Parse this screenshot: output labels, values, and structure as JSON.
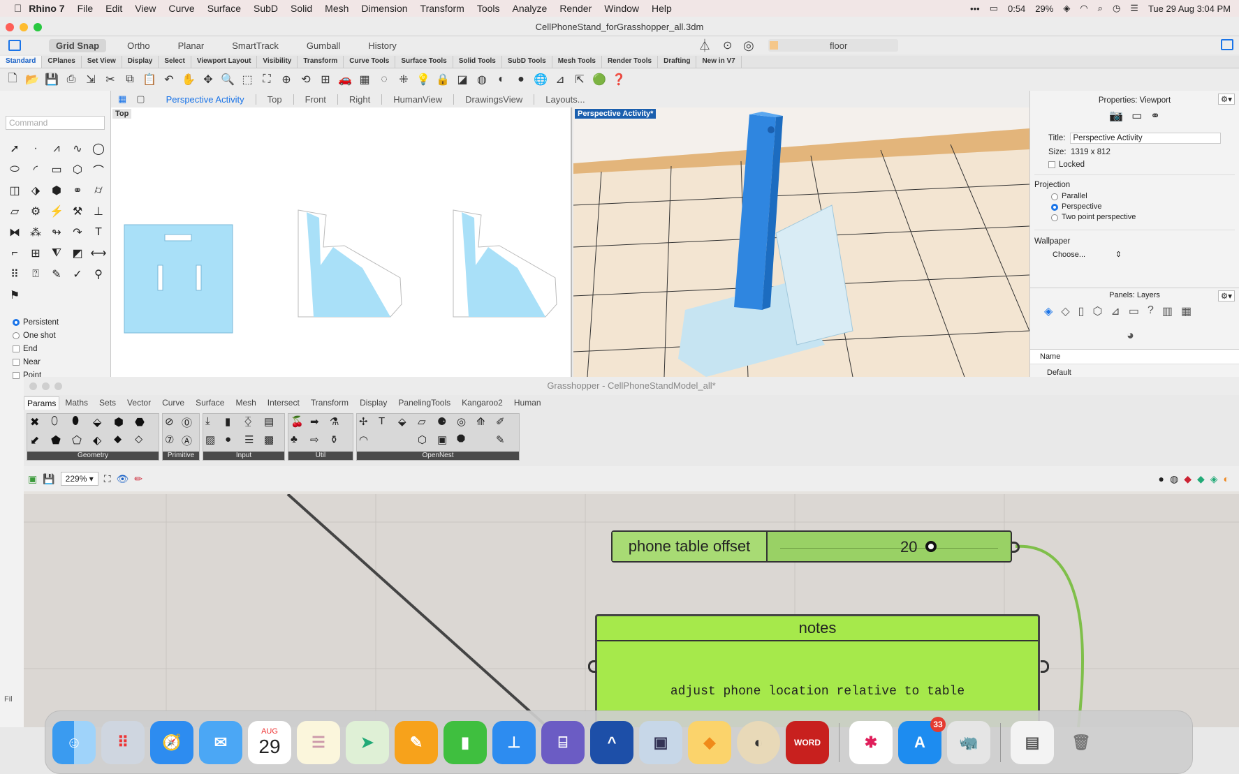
{
  "menubar": {
    "app": "Rhino 7",
    "items": [
      "File",
      "Edit",
      "View",
      "Curve",
      "Surface",
      "SubD",
      "Solid",
      "Mesh",
      "Dimension",
      "Transform",
      "Tools",
      "Analyze",
      "Render",
      "Window",
      "Help"
    ],
    "battery_time": "0:54",
    "battery_pct": "29%",
    "datetime": "Tue 29 Aug  3:04 PM"
  },
  "window": {
    "title": "CellPhoneStand_forGrasshopper_all.3dm"
  },
  "modes": {
    "grid_snap": "Grid Snap",
    "ortho": "Ortho",
    "planar": "Planar",
    "smarttrack": "SmartTrack",
    "gumball": "Gumball",
    "history": "History",
    "layer": "floor"
  },
  "toolbar_tabs": [
    "Standard",
    "CPlanes",
    "Set View",
    "Display",
    "Select",
    "Viewport Layout",
    "Visibility",
    "Transform",
    "Curve Tools",
    "Surface Tools",
    "Solid Tools",
    "SubD Tools",
    "Mesh Tools",
    "Render Tools",
    "Drafting",
    "New in V7"
  ],
  "command": {
    "placeholder": "Command"
  },
  "osnap": {
    "persistent": "Persistent",
    "one_shot": "One shot",
    "end": "End",
    "near": "Near",
    "point": "Point"
  },
  "viewport_tabs": [
    "Perspective Activity",
    "Top",
    "Front",
    "Right",
    "HumanView",
    "DrawingsView",
    "Layouts..."
  ],
  "viewports": {
    "top_label": "Top",
    "persp_label": "Perspective Activity*"
  },
  "properties": {
    "header": "Properties: Viewport",
    "title_label": "Title:",
    "title_value": "Perspective Activity",
    "size_label": "Size:",
    "size_value": "1319 x 812",
    "locked": "Locked",
    "projection": "Projection",
    "parallel": "Parallel",
    "perspective": "Perspective",
    "two_point": "Two point perspective",
    "wallpaper": "Wallpaper",
    "choose": "Choose...",
    "layers_header": "Panels: Layers",
    "name_col": "Name",
    "default_layer": "Default"
  },
  "grasshopper": {
    "title": "Grasshopper - CellPhoneStandModel_all*",
    "tabs": [
      "Params",
      "Maths",
      "Sets",
      "Vector",
      "Curve",
      "Surface",
      "Mesh",
      "Intersect",
      "Transform",
      "Display",
      "PanelingTools",
      "Kangaroo2",
      "Human"
    ],
    "groups": [
      "Geometry",
      "Primitive",
      "Input",
      "Util",
      "OpenNest"
    ],
    "zoom": "229%",
    "slider_name": "phone table offset",
    "slider_value": "20",
    "notes_title": "notes",
    "notes_text": "adjust phone location relative to table",
    "file_label": "Fil"
  },
  "dock": {
    "calendar_month": "AUG",
    "calendar_day": "29",
    "appstore_badge": "33"
  }
}
